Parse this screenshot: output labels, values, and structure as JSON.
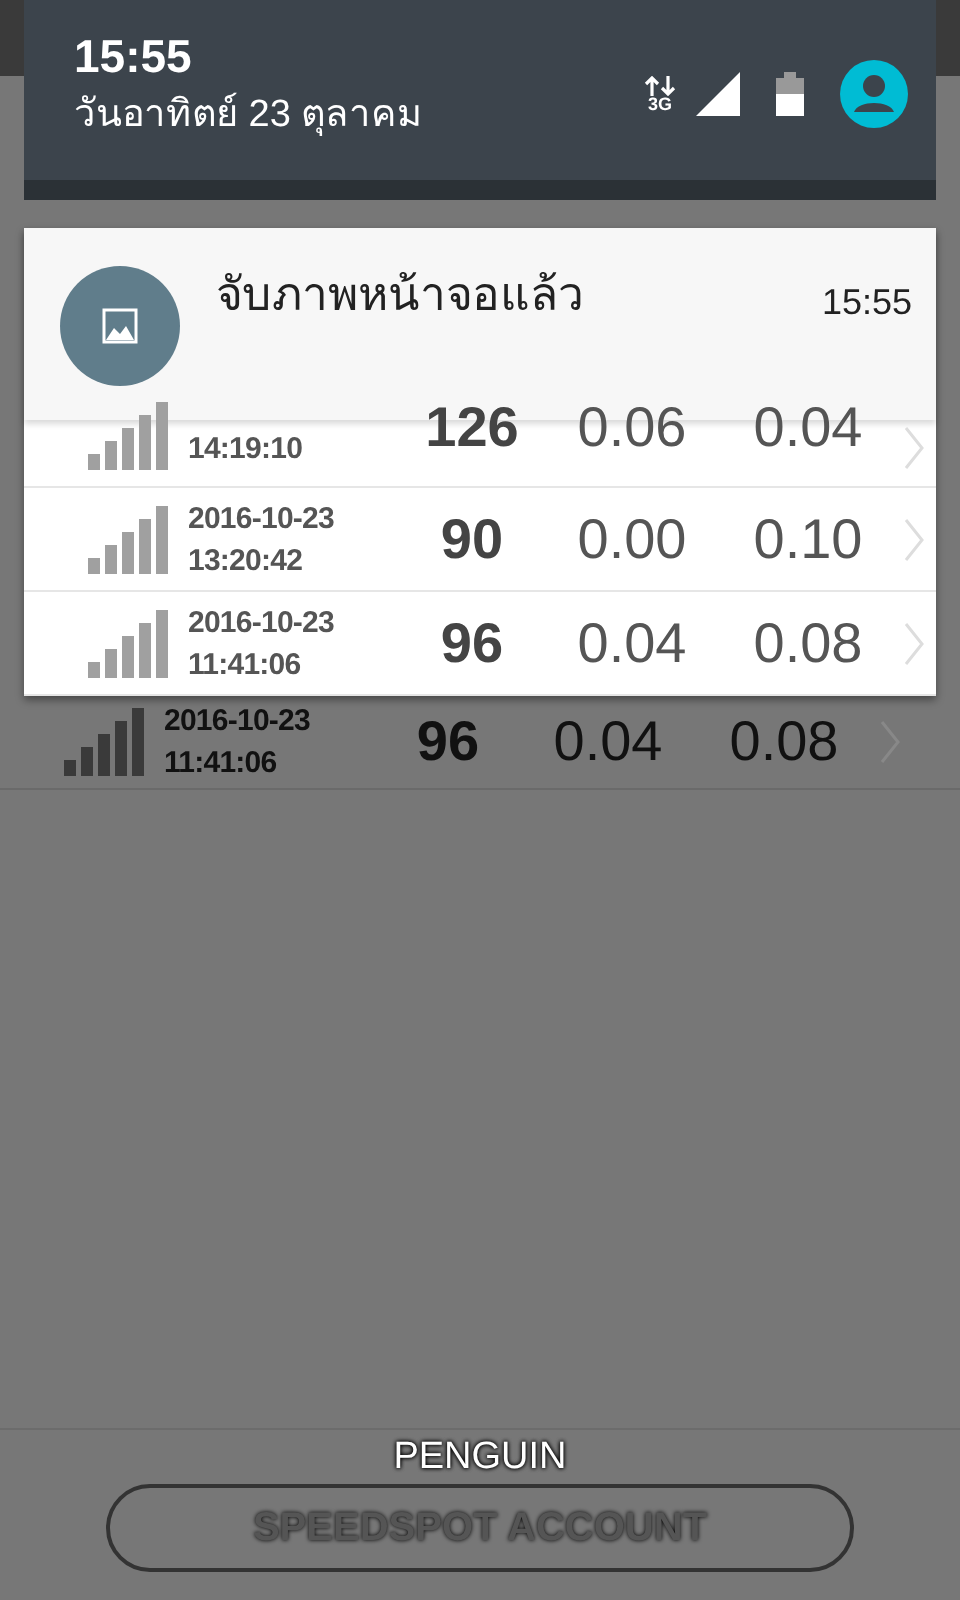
{
  "status_bar": {
    "time": "15:55",
    "date": "วันอาทิตย์ 23 ตุลาคม",
    "network": "3G"
  },
  "notification": {
    "title": "จับภาพหน้าจอแล้ว",
    "time": "15:55",
    "rows": [
      {
        "time": "14:19:10",
        "ping": "126",
        "download": "0.06",
        "upload": "0.04"
      },
      {
        "date": "2016-10-23",
        "time": "13:20:42",
        "ping": "90",
        "download": "0.00",
        "upload": "0.10"
      },
      {
        "date": "2016-10-23",
        "time": "11:41:06",
        "ping": "96",
        "download": "0.04",
        "upload": "0.08"
      }
    ]
  },
  "history_rows": [
    {
      "date": "2016-10-23",
      "time": "11:41:06",
      "ping": "96",
      "download": "0.04",
      "upload": "0.08"
    }
  ],
  "footer": {
    "user": "PENGUIN",
    "button": "SPEEDSPOT ACCOUNT"
  }
}
